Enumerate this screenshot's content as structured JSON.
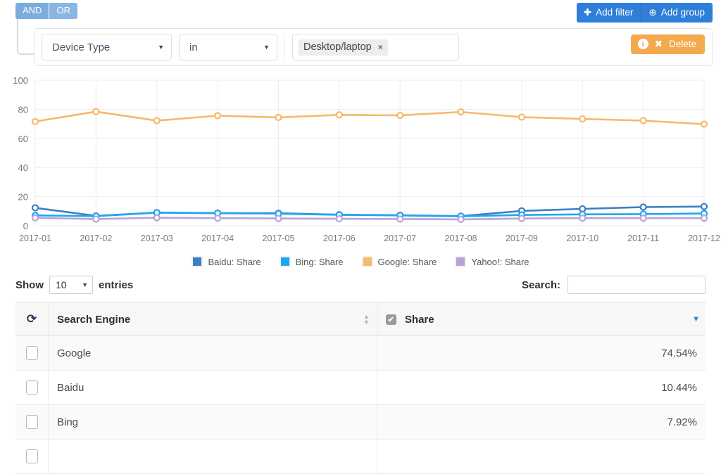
{
  "filter_builder": {
    "logic_and": "AND",
    "logic_or": "OR",
    "add_filter_label": "Add filter",
    "add_group_label": "Add group",
    "delete_label": "Delete",
    "info_glyph": "i",
    "plus_glyph": "✚",
    "circle_plus_glyph": "⊕",
    "x_glyph": "✖",
    "caret_glyph": "▼",
    "rows": [
      {
        "field": "Device Type",
        "operator": "in",
        "value_token": "Desktop/laptop",
        "token_remove_glyph": "×"
      }
    ]
  },
  "chart_data": {
    "type": "line",
    "title": "",
    "xlabel": "",
    "ylabel": "",
    "ylim": [
      0,
      100
    ],
    "yticks": [
      0,
      20,
      40,
      60,
      80,
      100
    ],
    "grid": true,
    "legend_position": "bottom",
    "categories": [
      "2017-01",
      "2017-02",
      "2017-03",
      "2017-04",
      "2017-05",
      "2017-06",
      "2017-07",
      "2017-08",
      "2017-09",
      "2017-10",
      "2017-11",
      "2017-12"
    ],
    "series": [
      {
        "name": "Baidu: Share",
        "color": "#3c7fc4",
        "values": [
          12.3,
          6.8,
          9.0,
          8.7,
          8.6,
          7.6,
          7.2,
          6.6,
          10.2,
          11.6,
          12.8,
          13.2
        ]
      },
      {
        "name": "Bing: Share",
        "color": "#1ca8f0",
        "values": [
          7.1,
          6.6,
          9.0,
          8.6,
          8.3,
          7.5,
          7.1,
          6.5,
          7.4,
          7.8,
          8.0,
          8.4
        ]
      },
      {
        "name": "Google: Share",
        "color": "#f5b96b",
        "values": [
          71.6,
          78.4,
          72.2,
          75.6,
          74.4,
          76.2,
          75.8,
          78.2,
          74.6,
          73.4,
          72.2,
          69.8
        ]
      },
      {
        "name": "Yahoo!: Share",
        "color": "#b8a3d9",
        "values": [
          5.4,
          4.6,
          5.5,
          5.2,
          5.0,
          4.8,
          4.6,
          4.4,
          5.0,
          5.2,
          5.2,
          5.2
        ]
      }
    ]
  },
  "table": {
    "show_label": "Show",
    "entries_label": "entries",
    "page_length": "10",
    "page_length_caret": "▼",
    "search_label": "Search:",
    "search_value": "",
    "search_placeholder": "",
    "refresh_icon_glyph": "⟳",
    "header_checkbox_glyph": "✔",
    "sort_asc_glyph": "▲",
    "sort_desc_glyph": "▼",
    "column_menu_glyph": "▼",
    "columns": [
      "Search Engine",
      "Share"
    ],
    "rows": [
      {
        "engine": "Google",
        "share": "74.54%"
      },
      {
        "engine": "Baidu",
        "share": "10.44%"
      },
      {
        "engine": "Bing",
        "share": "7.92%"
      },
      {
        "engine": "",
        "share": ""
      }
    ]
  }
}
